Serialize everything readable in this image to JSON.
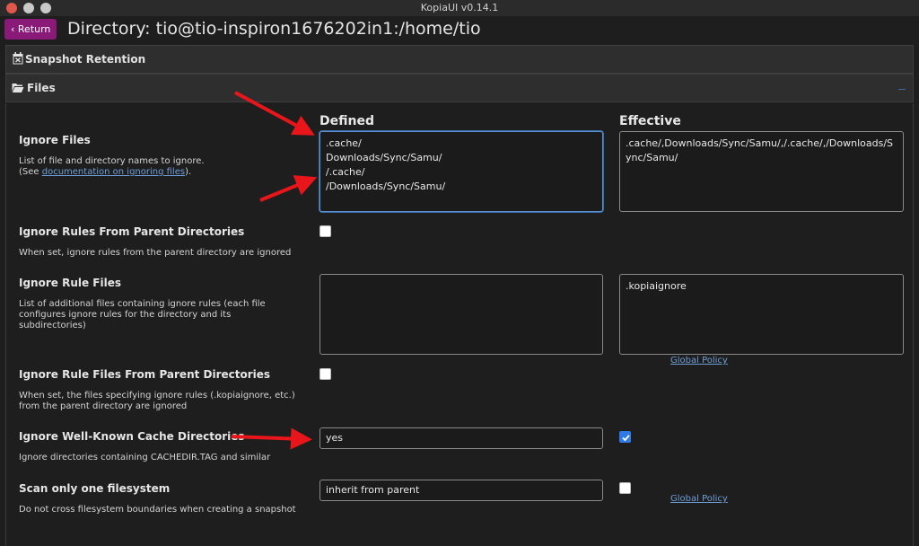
{
  "window": {
    "title": "KopiaUI v0.14.1"
  },
  "header": {
    "return_label": "Return",
    "page_title": "Directory: tio@tio-inspiron1676202in1:/home/tio"
  },
  "sections": {
    "snapshot_retention": "Snapshot Retention",
    "files": "Files"
  },
  "columns": {
    "defined": "Defined",
    "effective": "Effective"
  },
  "rows": {
    "ignore_files": {
      "label": "Ignore Files",
      "desc_line1": "List of file and directory names to ignore.",
      "desc_pre": "(See ",
      "desc_link": "documentation on ignoring files",
      "desc_post": ").",
      "defined": ".cache/\nDownloads/Sync/Samu/\n/.cache/\n/Downloads/Sync/Samu/",
      "effective": ".cache/,Downloads/Sync/Samu/,/.cache/,/Downloads/Sync/Samu/"
    },
    "ignore_parent_rules": {
      "label": "Ignore Rules From Parent Directories",
      "desc": "When set, ignore rules from the parent directory are ignored",
      "checked": false
    },
    "ignore_rule_files": {
      "label": "Ignore Rule Files",
      "desc": "List of additional files containing ignore rules (each file configures ignore rules for the directory and its subdirectories)",
      "defined": "",
      "effective": ".kopiaignore",
      "policy_link": "Global Policy"
    },
    "ignore_rule_files_parent": {
      "label": "Ignore Rule Files From Parent Directories",
      "desc": "When set, the files specifying ignore rules (.kopiaignore, etc.) from the parent directory are ignored",
      "checked": false
    },
    "ignore_cache_dirs": {
      "label": "Ignore Well-Known Cache Directories",
      "desc": "Ignore directories containing CACHEDIR.TAG and similar",
      "defined": "yes",
      "effective_checked": true
    },
    "one_filesystem": {
      "label": "Scan only one filesystem",
      "desc": "Do not cross filesystem boundaries when creating a snapshot",
      "defined": "inherit from parent",
      "effective_checked": false,
      "policy_link": "Global Policy"
    }
  },
  "colors": {
    "accent": "#8a1a78",
    "link": "#6f9fd8",
    "checkbox": "#2f7ae5",
    "annotation_arrow": "#e8161a"
  }
}
